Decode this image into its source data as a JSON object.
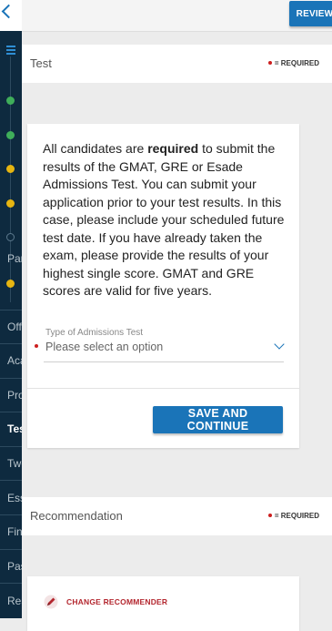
{
  "topbar": {
    "review_label": "REVIEW"
  },
  "sidebar": {
    "items": [
      {
        "label": "Par"
      },
      {
        "label": "Off"
      },
      {
        "label": "Aca"
      },
      {
        "label": "Pro"
      },
      {
        "label": "Tes",
        "active": true
      },
      {
        "label": "Two"
      },
      {
        "label": "Ess"
      },
      {
        "label": "Fin"
      },
      {
        "label": "Pas"
      },
      {
        "label": "Res"
      }
    ],
    "status_colors": {
      "complete": "#3fae5a",
      "in_progress": "#e6b511"
    }
  },
  "test_section": {
    "title": "Test",
    "required_label": "= REQUIRED",
    "info_prefix": "All candidates are ",
    "info_bold": "required",
    "info_suffix": " to submit the results of the GMAT, GRE or Esade Admissions Test. You can submit your application prior to your test results. In this case, please include your scheduled future test date. If you have already taken the exam, please provide the results of your highest single score. GMAT and GRE scores are valid for five years.",
    "select_label": "Type of Admissions Test",
    "select_placeholder": "Please select an option",
    "save_label": "SAVE AND CONTINUE"
  },
  "recommendation_section": {
    "title": "Recommendation",
    "required_label": "= REQUIRED",
    "change_label": "CHANGE RECOMMENDER"
  },
  "colors": {
    "accent": "#1a74b8",
    "required": "#cc1f1f",
    "sidebar_bg": "#0e2a3f"
  }
}
